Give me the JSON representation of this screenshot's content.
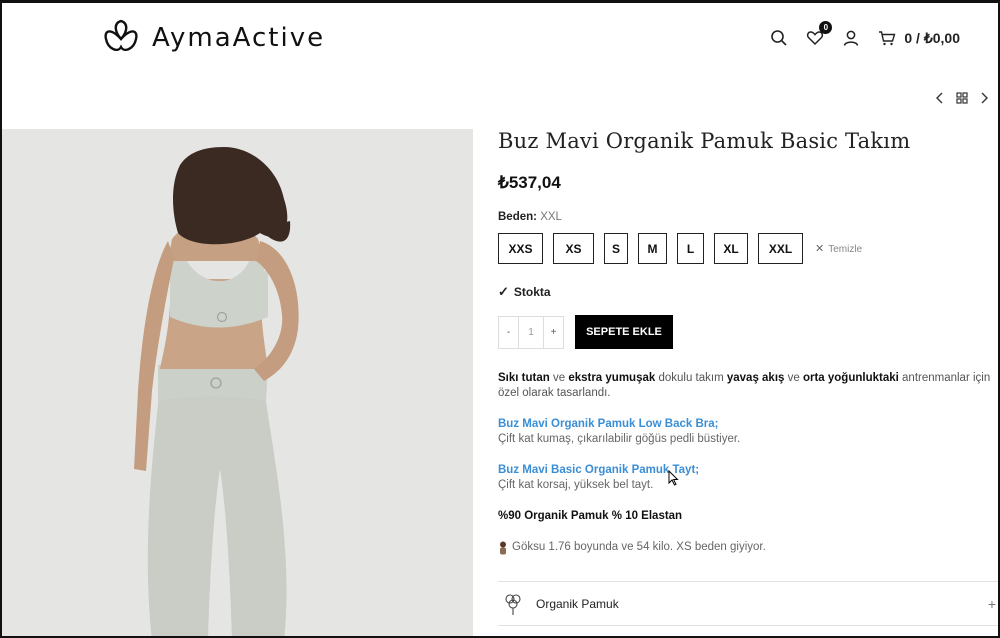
{
  "header": {
    "logo_text": "AymaActive",
    "wishlist_count": "0",
    "cart_total": "0 / ₺0,00"
  },
  "product": {
    "title": "Buz Mavi Organik Pamuk Basic Takım",
    "price": "₺537,04",
    "size_label": "Beden:",
    "selected_size": "XXL",
    "sizes": [
      "XXS",
      "XS",
      "S",
      "M",
      "L",
      "XL",
      "XXL"
    ],
    "clear_label": "Temizle",
    "stock": "Stokta",
    "quantity": "1",
    "qty_minus": "-",
    "qty_plus": "+",
    "add_to_cart": "SEPETE EKLE"
  },
  "description": {
    "p1_b1": "Sıkı tutan",
    "p1_t1": " ve ",
    "p1_b2": "ekstra yumuşak",
    "p1_t2": " dokulu takım ",
    "p1_b3": "yavaş akış",
    "p1_t3": " ve ",
    "p1_b4": "orta yoğunluktaki",
    "p1_t4": " antrenmanlar için özel olarak tasarlandı.",
    "link1": "Buz Mavi Organik Pamuk Low Back Bra;",
    "sub1": "Çift kat kumaş, çıkarılabilir göğüs pedli büstiyer.",
    "link2": "Buz Mavi Basic Organik Pamuk Tayt;",
    "sub2": "Çift kat korsaj, yüksek bel tayt.",
    "material": "%90 Organik Pamuk  % 10 Elastan",
    "model": "Göksu 1.76 boyunda ve 54 kilo. XS beden giyiyor."
  },
  "accordion": {
    "item1": "Organik Pamuk",
    "item1_plus": "+"
  },
  "colors": {
    "link": "#3a8ed6",
    "button": "#000000",
    "image_bg": "#e4e5e3"
  }
}
